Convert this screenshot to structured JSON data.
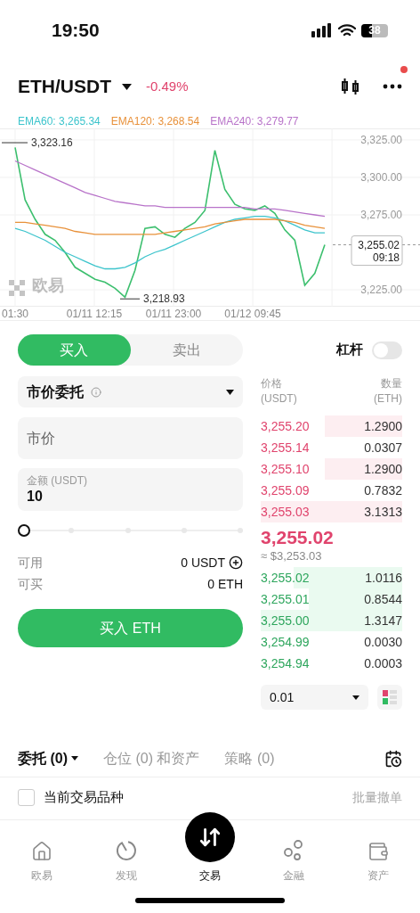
{
  "status_bar": {
    "time": "19:50",
    "battery": "38"
  },
  "header": {
    "pair": "ETH/USDT",
    "change": "-0.49%",
    "notification": true
  },
  "chart": {
    "watermark": "欧易",
    "high_label": "3,323.16",
    "low_label": "3,218.93",
    "last_price": "3,255.02",
    "countdown": "09:18",
    "chart_data": {
      "type": "line",
      "grid": true,
      "series": [
        {
          "color": "#3cbf6e",
          "values": [
            3320,
            3285,
            3272,
            3262,
            3258,
            3250,
            3240,
            3236,
            3232,
            3230,
            3226,
            3220,
            3238,
            3266,
            3267,
            3262,
            3260,
            3266,
            3270,
            3278,
            3318,
            3292,
            3282,
            3279,
            3278,
            3281,
            3276,
            3265,
            3258,
            3228,
            3236,
            3255
          ]
        },
        {
          "name": "EMA60: 3,265.34",
          "color": "#3cc4cc",
          "values": [
            3266,
            3264,
            3261,
            3258,
            3254,
            3250,
            3247,
            3244,
            3241,
            3239,
            3239,
            3240,
            3243,
            3247,
            3250,
            3252,
            3255,
            3258,
            3261,
            3264,
            3267,
            3270,
            3272,
            3273,
            3274,
            3274,
            3273,
            3271,
            3268,
            3265,
            3263,
            3263
          ]
        },
        {
          "name": "EMA120: 3,268.54",
          "color": "#e8913a",
          "values": [
            3270,
            3270,
            3269,
            3268,
            3267,
            3266,
            3264,
            3263,
            3262,
            3262,
            3262,
            3262,
            3262,
            3262,
            3262,
            3263,
            3264,
            3265,
            3266,
            3267,
            3269,
            3270,
            3271,
            3272,
            3272,
            3272,
            3272,
            3271,
            3270,
            3268,
            3267,
            3266
          ]
        },
        {
          "name": "EMA240: 3,279.77",
          "color": "#b873c9",
          "values": [
            3311,
            3308,
            3305,
            3302,
            3299,
            3296,
            3293,
            3290,
            3288,
            3286,
            3284,
            3283,
            3282,
            3281,
            3281,
            3280,
            3280,
            3280,
            3280,
            3280,
            3280,
            3280,
            3280,
            3280,
            3279,
            3279,
            3279,
            3278,
            3277,
            3276,
            3275,
            3274
          ]
        }
      ],
      "yticks": [
        {
          "value": 3325,
          "label": "3,325.00"
        },
        {
          "value": 3300,
          "label": "3,300.00"
        },
        {
          "value": 3275,
          "label": "3,275.00"
        },
        {
          "value": 3225,
          "label": "3,225.00"
        }
      ],
      "ylim": [
        3213.7,
        3332.7
      ]
    },
    "time_labels": [
      "01:30",
      "01/11 12:15",
      "01/11 23:00",
      "01/12 09:45"
    ]
  },
  "trade_tabs": [
    {
      "label": "买入",
      "selected": true
    },
    {
      "label": "卖出",
      "selected": false
    }
  ],
  "leverage": {
    "label": "杠杆",
    "on": false
  },
  "order_type": "市价委托",
  "price_field": {
    "placeholder": "市价"
  },
  "amount_field": {
    "label": "金额 (USDT)",
    "value": "10"
  },
  "slider": {
    "level": 0
  },
  "balances": [
    {
      "label": "可用",
      "value": "0 USDT",
      "add": true
    },
    {
      "label": "可买",
      "value": "0 ETH",
      "add": false
    }
  ],
  "submit": "买入 ETH",
  "order_book": {
    "price_label": "价格",
    "price_unit": "(USDT)",
    "qty_label": "数量",
    "qty_unit": "(ETH)",
    "asks": [
      {
        "price": "3,255.20",
        "qty": "1.2900"
      },
      {
        "price": "3,255.14",
        "qty": "0.0307"
      },
      {
        "price": "3,255.10",
        "qty": "1.2900"
      },
      {
        "price": "3,255.09",
        "qty": "0.7832"
      },
      {
        "price": "3,255.03",
        "qty": "3.1313"
      }
    ],
    "mid_price": "3,255.02",
    "mid_usd": "≈ $3,253.03",
    "bids": [
      {
        "price": "3,255.02",
        "qty": "1.0116"
      },
      {
        "price": "3,255.01",
        "qty": "0.8544"
      },
      {
        "price": "3,255.00",
        "qty": "1.3147"
      },
      {
        "price": "3,254.99",
        "qty": "0.0030"
      },
      {
        "price": "3,254.94",
        "qty": "0.0003"
      }
    ],
    "precision": "0.01"
  },
  "order_tabs": [
    {
      "label": "委托 (0)",
      "selected": true
    },
    {
      "label": "仓位 (0) 和资产",
      "selected": false
    },
    {
      "label": "策略 (0)",
      "selected": false
    }
  ],
  "filter": {
    "label": "当前交易品种",
    "checked": false
  },
  "cancel_all": "批量撤单",
  "nav": [
    {
      "label": "欧易",
      "kind": "home",
      "selected": false
    },
    {
      "label": "发现",
      "kind": "discover",
      "selected": false
    },
    {
      "label": "交易",
      "kind": "trade",
      "selected": true
    },
    {
      "label": "金融",
      "kind": "finance",
      "selected": false
    },
    {
      "label": "资产",
      "kind": "assets",
      "selected": false
    }
  ]
}
